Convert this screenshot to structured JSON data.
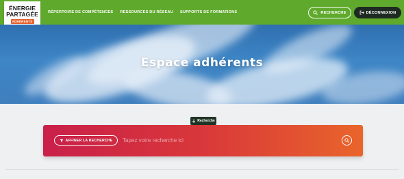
{
  "brand": {
    "line1": "ÉNERGIE",
    "line2": "PARTAGÉE",
    "badge": "ADHÉRENTS",
    "green": "#5faa2c",
    "orange": "#e8612c"
  },
  "nav": {
    "items": [
      {
        "label": "RÉPERTOIRE DE COMPÉTENCES"
      },
      {
        "label": "RESSOURCES DU RÉSEAU"
      },
      {
        "label": "SUPPORTS DE FORMATIONS"
      }
    ],
    "search_label": "RECHERCHE",
    "search_icon": "search-icon",
    "logout_label": "DÉCONNEXION",
    "logout_icon": "logout-icon"
  },
  "hero": {
    "title": "Espace adhérents"
  },
  "search": {
    "tag_label": "Recherche",
    "tag_icon": "arrow-down-icon",
    "filter_label": "AFFINER LA RECHERCHE",
    "filter_icon": "funnel-icon",
    "placeholder": "Tapez votre recherche ici",
    "submit_icon": "search-icon"
  }
}
